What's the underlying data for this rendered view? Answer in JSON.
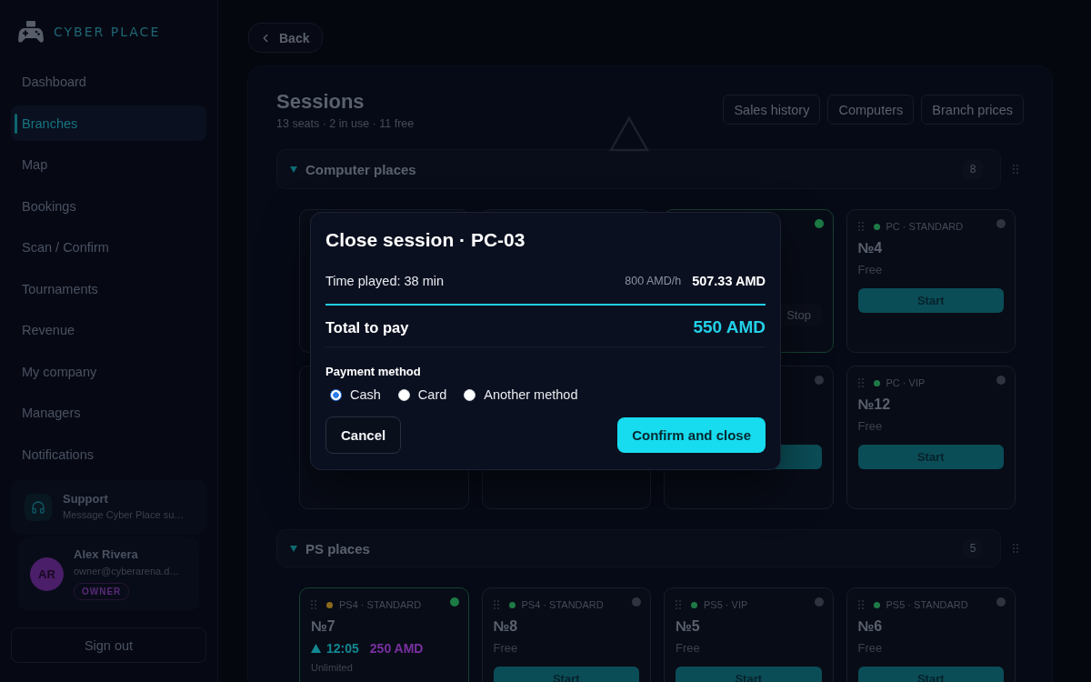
{
  "sidebar": {
    "logo": {
      "text": "CYBER PLACE"
    },
    "nav": [
      {
        "label": "Dashboard",
        "selected": false
      },
      {
        "label": "Branches",
        "selected": true
      },
      {
        "label": "Map",
        "selected": false
      },
      {
        "label": "Bookings",
        "selected": false
      },
      {
        "label": "Scan / Confirm",
        "selected": false
      },
      {
        "label": "Tournaments",
        "selected": false
      },
      {
        "label": "Revenue",
        "selected": false
      },
      {
        "label": "My company",
        "selected": false
      },
      {
        "label": "Managers",
        "selected": false
      },
      {
        "label": "Notifications",
        "selected": false
      }
    ],
    "support": {
      "title": "Support",
      "subtitle": "Message Cyber Place su…"
    },
    "user": {
      "initials": "AR",
      "name": "Alex Rivera",
      "email": "owner@cyberarena.d…",
      "role": "OWNER"
    },
    "sign_out": "Sign out"
  },
  "back_button": "Back",
  "page": {
    "title": "Sessions",
    "subtitle": "13 seats · 2 in use · 11 free",
    "actions": [
      "Sales history",
      "Computers",
      "Branch prices"
    ]
  },
  "sections": [
    {
      "title": "Computer places",
      "count": "8",
      "expanded": true,
      "cards": [
        {
          "busy": false
        },
        {
          "busy": false
        },
        {
          "busy": true,
          "indicator": true,
          "action": {
            "kind": "stop",
            "label": "Stop"
          }
        },
        {
          "busy": false,
          "indicator": true,
          "color": "#1e7a46",
          "type": "PC · STANDARD",
          "number": "№4",
          "status": "Free",
          "action": {
            "kind": "start",
            "label": "Start"
          }
        },
        {
          "busy": false
        },
        {
          "busy": false
        },
        {
          "busy": false,
          "indicator": true,
          "action": {
            "kind": "start"
          }
        },
        {
          "busy": false,
          "indicator": true,
          "color": "#1e7a46",
          "type": "PC · VIP",
          "number": "№12",
          "status": "Free",
          "action": {
            "kind": "start",
            "label": "Start"
          }
        }
      ]
    },
    {
      "title": "PS places",
      "count": "5",
      "expanded": true,
      "cards": [
        {
          "busy": true,
          "indicator": true,
          "color": "#8c6a1c",
          "type": "PS4 · STANDARD",
          "number": "№7",
          "timer": "12:05",
          "amount": "250 AMD",
          "note": "Unlimited"
        },
        {
          "busy": false,
          "indicator": true,
          "color": "#1e7a46",
          "type": "PS4 · STANDARD",
          "number": "№8",
          "status": "Free",
          "action": {
            "kind": "start",
            "label": "Start"
          }
        },
        {
          "busy": false,
          "indicator": true,
          "color": "#1e7a46",
          "type": "PS5 · VIP",
          "number": "№5",
          "status": "Free",
          "action": {
            "kind": "start",
            "label": "Start"
          }
        },
        {
          "busy": false,
          "indicator": true,
          "color": "#1e7a46",
          "type": "PS5 · STANDARD",
          "number": "№6",
          "status": "Free",
          "action": {
            "kind": "start",
            "label": "Start"
          }
        }
      ]
    }
  ],
  "dialog": {
    "title": "Close session · PC-03",
    "time_played": "Time played: 38 min",
    "rate": "800 AMD/h",
    "subtotal": "507.33 AMD",
    "total_label": "Total to pay",
    "total": "550 AMD",
    "payment_label": "Payment method",
    "payment_options": [
      {
        "label": "Cash",
        "selected": true
      },
      {
        "label": "Card",
        "selected": false
      },
      {
        "label": "Another method",
        "selected": false
      }
    ],
    "cancel": "Cancel",
    "confirm": "Confirm and close"
  }
}
